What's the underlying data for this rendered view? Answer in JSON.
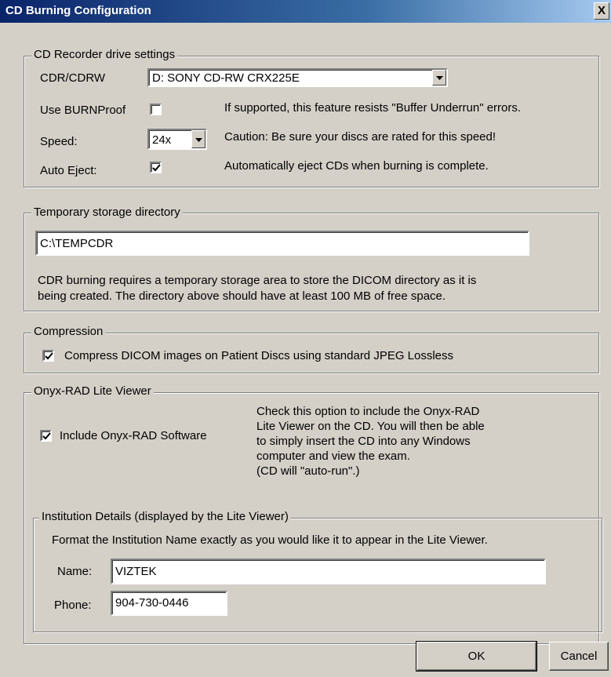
{
  "window": {
    "title": "CD Burning Configuration",
    "close_label": "X"
  },
  "recorder": {
    "legend": "CD Recorder drive settings",
    "drive_label": "CDR/CDRW",
    "drive_value": "D: SONY CD-RW  CRX225E",
    "burnproof_label": "Use BURNProof",
    "burnproof_checked": false,
    "burnproof_note": "If supported, this feature resists \"Buffer Underrun\" errors.",
    "speed_label": "Speed:",
    "speed_value": "24x",
    "speed_note": "Caution: Be sure your discs are rated for this speed!",
    "eject_label": "Auto Eject:",
    "eject_checked": true,
    "eject_note": "Automatically eject CDs when burning is complete."
  },
  "temp": {
    "legend": "Temporary storage directory",
    "path_value": "C:\\TEMPCDR",
    "note_line1": "CDR burning requires a temporary storage area to store the DICOM directory as it is",
    "note_line2": "being created.  The directory above should have at least 100 MB of free space."
  },
  "compression": {
    "legend": "Compression",
    "checked": true,
    "label": "Compress DICOM images on Patient Discs using standard JPEG Lossless"
  },
  "viewer": {
    "legend": "Onyx-RAD Lite Viewer",
    "include_checked": true,
    "include_label": "Include Onyx-RAD Software",
    "info_lines": [
      "Check this option to include the Onyx-RAD",
      "Lite Viewer on the CD.  You will then be able",
      "to simply insert the CD into any Windows",
      "computer and view the exam.",
      "(CD will \"auto-run\".)"
    ]
  },
  "institution": {
    "legend": "Institution Details (displayed by the Lite Viewer)",
    "instructions": "Format the Institution Name exactly as you would like it to appear in the Lite Viewer.",
    "name_label": "Name:",
    "name_value": "VIZTEK",
    "phone_label": "Phone:",
    "phone_value": "904-730-0446"
  },
  "buttons": {
    "ok": "OK",
    "cancel": "Cancel"
  }
}
